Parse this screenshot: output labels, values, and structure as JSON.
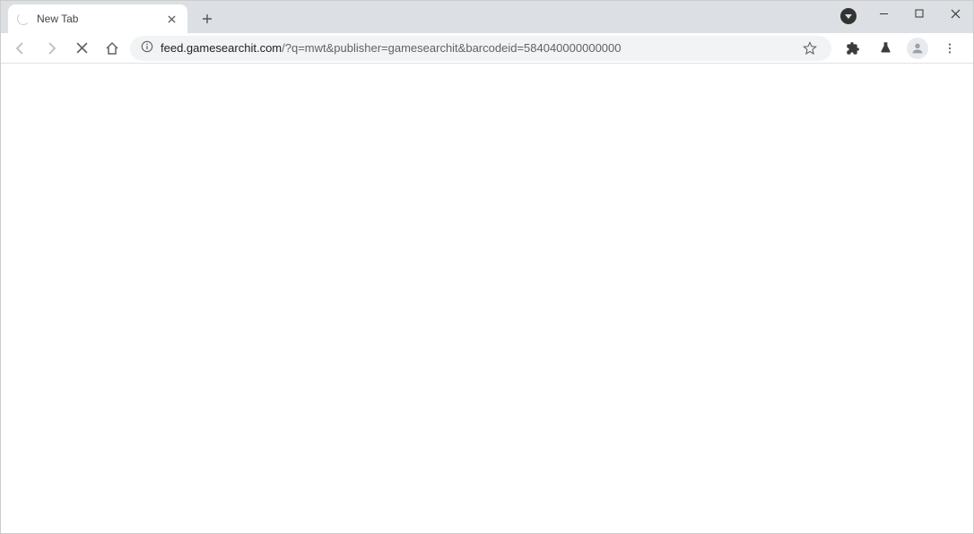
{
  "tab": {
    "title": "New Tab"
  },
  "address": {
    "host": "feed.gamesearchit.com",
    "path": "/?q=mwt&publisher=gamesearchit&barcodeid=584040000000000"
  }
}
